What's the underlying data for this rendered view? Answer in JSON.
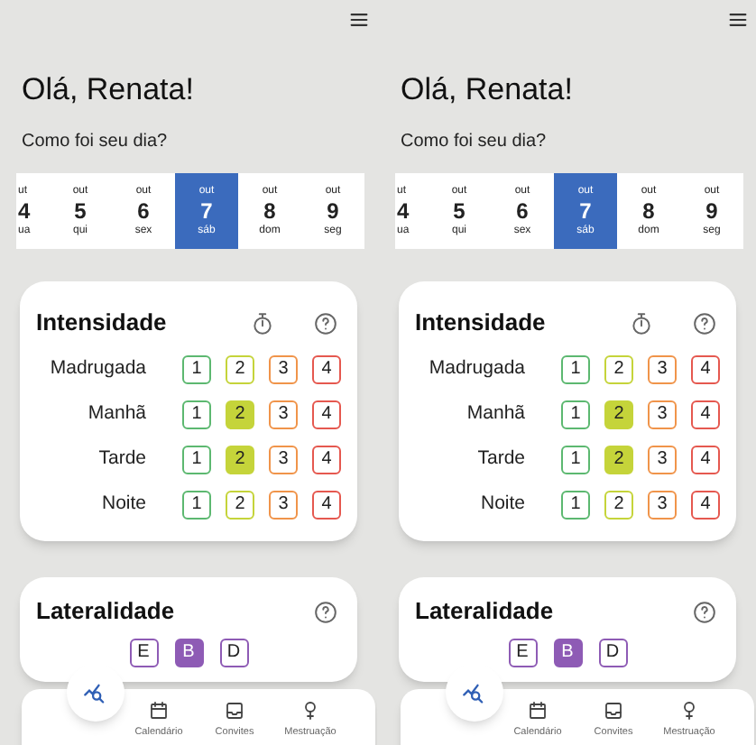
{
  "screens": [
    {
      "greeting": "Olá, Renata!",
      "question": "Como foi seu dia?",
      "days": [
        {
          "month": "ut",
          "day": "4",
          "weekday": "ua",
          "selected": false
        },
        {
          "month": "out",
          "day": "5",
          "weekday": "qui",
          "selected": false
        },
        {
          "month": "out",
          "day": "6",
          "weekday": "sex",
          "selected": false
        },
        {
          "month": "out",
          "day": "7",
          "weekday": "sáb",
          "selected": true
        },
        {
          "month": "out",
          "day": "8",
          "weekday": "dom",
          "selected": false
        },
        {
          "month": "out",
          "day": "9",
          "weekday": "seg",
          "selected": false
        }
      ],
      "intensity": {
        "title": "Intensidade",
        "rows": [
          {
            "label": "Madrugada",
            "options": [
              {
                "label": "1",
                "color": "#5cb870",
                "selected": false
              },
              {
                "label": "2",
                "color": "#c5d43a",
                "selected": false
              },
              {
                "label": "3",
                "color": "#f0944a",
                "selected": false
              },
              {
                "label": "4",
                "color": "#e5584f",
                "selected": false
              }
            ]
          },
          {
            "label": "Manhã",
            "options": [
              {
                "label": "1",
                "color": "#5cb870",
                "selected": false
              },
              {
                "label": "2",
                "color": "#c5d43a",
                "selected": true
              },
              {
                "label": "3",
                "color": "#f0944a",
                "selected": false
              },
              {
                "label": "4",
                "color": "#e5584f",
                "selected": false
              }
            ]
          },
          {
            "label": "Tarde",
            "options": [
              {
                "label": "1",
                "color": "#5cb870",
                "selected": false
              },
              {
                "label": "2",
                "color": "#c5d43a",
                "selected": true
              },
              {
                "label": "3",
                "color": "#f0944a",
                "selected": false
              },
              {
                "label": "4",
                "color": "#e5584f",
                "selected": false
              }
            ]
          },
          {
            "label": "Noite",
            "options": [
              {
                "label": "1",
                "color": "#5cb870",
                "selected": false
              },
              {
                "label": "2",
                "color": "#c5d43a",
                "selected": false
              },
              {
                "label": "3",
                "color": "#f0944a",
                "selected": false
              },
              {
                "label": "4",
                "color": "#e5584f",
                "selected": false
              }
            ]
          }
        ]
      },
      "laterality": {
        "title": "Lateralidade",
        "options": [
          {
            "label": "E",
            "selected": false
          },
          {
            "label": "B",
            "selected": true
          },
          {
            "label": "D",
            "selected": false
          }
        ]
      },
      "nav": [
        "Calendário",
        "Convites",
        "Mestruação"
      ]
    },
    {
      "greeting": "Olá, Renata!",
      "question": "Como foi seu dia?",
      "days": [
        {
          "month": "ut",
          "day": "4",
          "weekday": "ua",
          "selected": false
        },
        {
          "month": "out",
          "day": "5",
          "weekday": "qui",
          "selected": false
        },
        {
          "month": "out",
          "day": "6",
          "weekday": "sex",
          "selected": false
        },
        {
          "month": "out",
          "day": "7",
          "weekday": "sáb",
          "selected": true
        },
        {
          "month": "out",
          "day": "8",
          "weekday": "dom",
          "selected": false
        },
        {
          "month": "out",
          "day": "9",
          "weekday": "seg",
          "selected": false
        }
      ],
      "intensity": {
        "title": "Intensidade",
        "rows": [
          {
            "label": "Madrugada",
            "options": [
              {
                "label": "1",
                "color": "#5cb870",
                "selected": false
              },
              {
                "label": "2",
                "color": "#c5d43a",
                "selected": false
              },
              {
                "label": "3",
                "color": "#f0944a",
                "selected": false
              },
              {
                "label": "4",
                "color": "#e5584f",
                "selected": false
              }
            ]
          },
          {
            "label": "Manhã",
            "options": [
              {
                "label": "1",
                "color": "#5cb870",
                "selected": false
              },
              {
                "label": "2",
                "color": "#c5d43a",
                "selected": true
              },
              {
                "label": "3",
                "color": "#f0944a",
                "selected": false
              },
              {
                "label": "4",
                "color": "#e5584f",
                "selected": false
              }
            ]
          },
          {
            "label": "Tarde",
            "options": [
              {
                "label": "1",
                "color": "#5cb870",
                "selected": false
              },
              {
                "label": "2",
                "color": "#c5d43a",
                "selected": true
              },
              {
                "label": "3",
                "color": "#f0944a",
                "selected": false
              },
              {
                "label": "4",
                "color": "#e5584f",
                "selected": false
              }
            ]
          },
          {
            "label": "Noite",
            "options": [
              {
                "label": "1",
                "color": "#5cb870",
                "selected": false
              },
              {
                "label": "2",
                "color": "#c5d43a",
                "selected": false
              },
              {
                "label": "3",
                "color": "#f0944a",
                "selected": false
              },
              {
                "label": "4",
                "color": "#e5584f",
                "selected": false
              }
            ]
          }
        ]
      },
      "laterality": {
        "title": "Lateralidade",
        "options": [
          {
            "label": "E",
            "selected": false
          },
          {
            "label": "B",
            "selected": true
          },
          {
            "label": "D",
            "selected": false
          }
        ]
      },
      "nav": [
        "Calendário",
        "Convites",
        "Mestruação"
      ]
    }
  ]
}
